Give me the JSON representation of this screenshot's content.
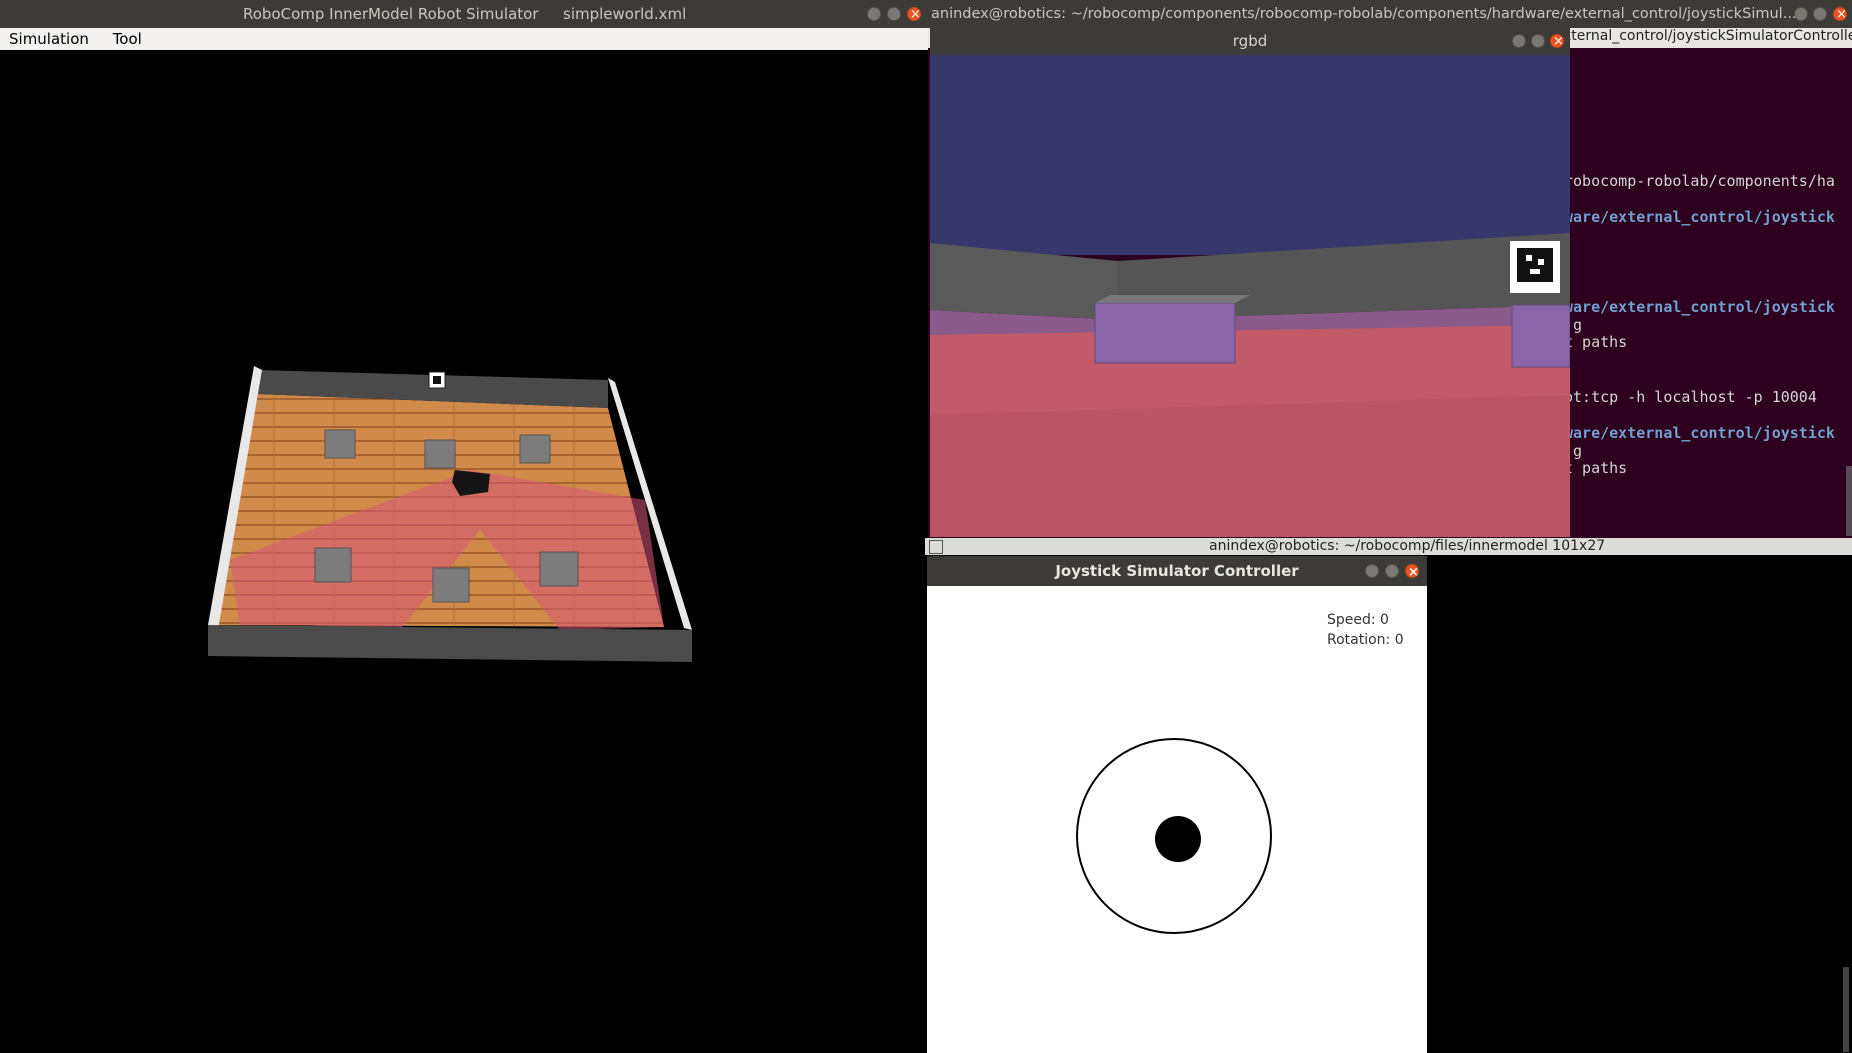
{
  "simulator": {
    "title": "RoboComp InnerModel Robot Simulator",
    "file": "simpleworld.xml",
    "menu": [
      "Simulation",
      "Tool"
    ]
  },
  "terminal_top": {
    "title": "anindex@robotics: ~/robocomp/components/robocomp-robolab/components/hardware/external_control/joystickSimul...",
    "tab_title": "xternal_control/joystickSimulatorControlle",
    "lines": [
      {
        "text": "robocomp-robolab/components/ha",
        "blue": false
      },
      {
        "text": "ware/external_control/joystick",
        "blue": true
      },
      {
        "text": "ware/external_control/joystick",
        "blue": true
      },
      {
        "text": ".g",
        "blue": false
      },
      {
        "text": "t paths",
        "blue": false
      },
      {
        "text": "ot:tcp -h localhost -p 10004",
        "blue": false
      },
      {
        "text": "ware/external_control/joystick",
        "blue": true
      },
      {
        "text": ".g",
        "blue": false
      },
      {
        "text": "t paths",
        "blue": false
      }
    ]
  },
  "terminal_bottom": {
    "title": "anindex@robotics: ~/robocomp/files/innermodel 101x27"
  },
  "rgbd": {
    "title": "rgbd"
  },
  "joystick": {
    "title": "Joystick Simulator Controller",
    "speed_label": "Speed: 0",
    "rotation_label": "Rotation: 0"
  },
  "colors": {
    "titlebar": "#3c3b37",
    "close_button": "#e95420",
    "terminal_blue": "#729fcf",
    "sky": "#37376b",
    "floor": "#c25a6a"
  },
  "icons": {
    "minimize": "minimize-icon",
    "maximize": "maximize-icon",
    "close": "close-icon"
  }
}
